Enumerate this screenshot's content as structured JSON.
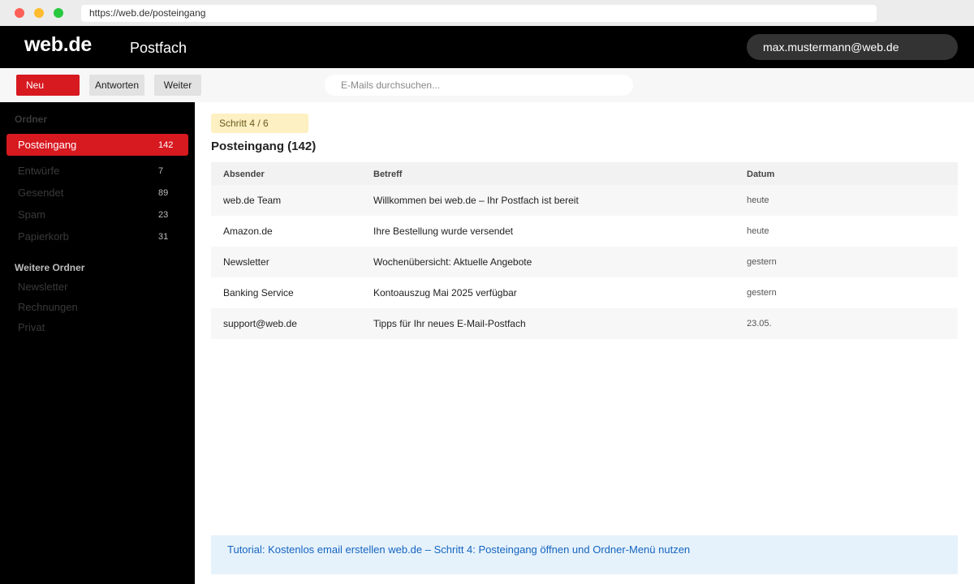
{
  "browser": {
    "url": "https://web.de/posteingang"
  },
  "header": {
    "logo": "web.de",
    "app_title": "Postfach",
    "account": "max.mustermann@web.de"
  },
  "toolbar": {
    "new_label": "Neu",
    "reply_label": "Antworten",
    "forward_label": "Weiter",
    "search_placeholder": "E-Mails durchsuchen..."
  },
  "sidebar": {
    "heading": "Ordner",
    "folders": [
      {
        "label": "Posteingang",
        "count": "142",
        "active": true
      },
      {
        "label": "Entwürfe",
        "count": "7"
      },
      {
        "label": "Gesendet",
        "count": "89"
      },
      {
        "label": "Spam",
        "count": "23"
      },
      {
        "label": "Papierkorb",
        "count": "31"
      }
    ],
    "more_heading": "Weitere Ordner",
    "more_folders": [
      "Newsletter",
      "Rechnungen",
      "Privat"
    ]
  },
  "main": {
    "step_badge": "Schritt 4 / 6",
    "title": "Posteingang (142)",
    "columns": [
      "Absender",
      "Betreff",
      "Datum"
    ],
    "emails": [
      {
        "sender": "web.de Team",
        "subject": "Willkommen bei web.de – Ihr Postfach ist bereit",
        "date": "heute"
      },
      {
        "sender": "Amazon.de",
        "subject": "Ihre Bestellung wurde versendet",
        "date": "heute"
      },
      {
        "sender": "Newsletter",
        "subject": "Wochenübersicht: Aktuelle Angebote",
        "date": "gestern"
      },
      {
        "sender": "Banking Service",
        "subject": "Kontoauszug Mai 2025 verfügbar",
        "date": "gestern"
      },
      {
        "sender": "support@web.de",
        "subject": "Tipps für Ihr neues E-Mail-Postfach",
        "date": "23.05."
      }
    ],
    "tutorial": "Tutorial: Kostenlos email erstellen web.de – Schritt 4: Posteingang öffnen und Ordner-Menü nutzen"
  },
  "colors": {
    "brand_red": "#d71920",
    "header_bg": "#000000",
    "tutorial_bg": "#e6f2fb",
    "tutorial_text": "#1565c0"
  }
}
